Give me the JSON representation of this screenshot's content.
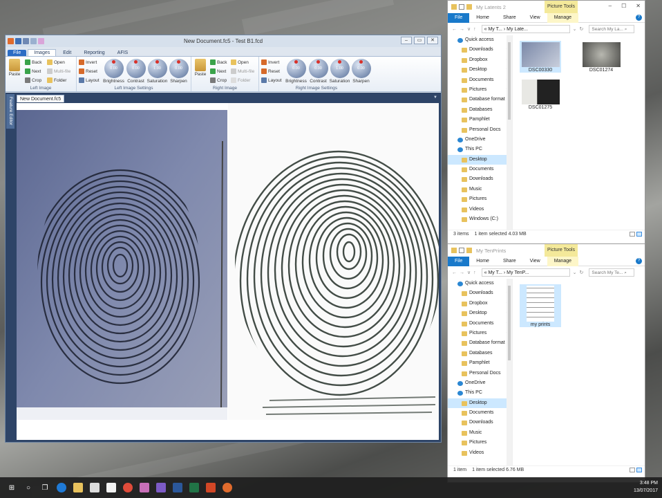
{
  "app": {
    "title": "New Document.fc5 - Test B1.fcd",
    "win_buttons": [
      "–",
      "▭",
      "✕"
    ],
    "tabs": [
      "File",
      "Images",
      "Edit",
      "Reporting",
      "AFIS"
    ],
    "active_tab": "Images",
    "left_group": {
      "paste": "Paste",
      "back": "Back",
      "next": "Next",
      "crop": "Crop",
      "open": "Open",
      "multifile": "Multi-file",
      "folder": "Folder",
      "label": "Left Image"
    },
    "left_settings": {
      "invert": "Invert",
      "reset": "Reset",
      "layout": "Layout",
      "knobs": [
        {
          "name": "Brightness",
          "value": "0.00"
        },
        {
          "name": "Contrast",
          "value": "0.00"
        },
        {
          "name": "Saturation",
          "value": "1.00"
        },
        {
          "name": "Sharpen",
          "value": "0.00"
        }
      ],
      "label": "Left Image Settings"
    },
    "right_group": {
      "paste": "Paste",
      "back": "Back",
      "next": "Next",
      "crop": "Crop",
      "open": "Open",
      "multifile": "Multi-file",
      "folder": "Folder",
      "label": "Right Image"
    },
    "right_settings": {
      "invert": "Invert",
      "reset": "Reset",
      "layout": "Layout",
      "knobs": [
        {
          "name": "Brightness",
          "value": "0.00"
        },
        {
          "name": "Contrast",
          "value": "0.00"
        },
        {
          "name": "Saturation",
          "value": "1.00"
        },
        {
          "name": "Sharpen",
          "value": "0.00"
        }
      ],
      "label": "Right Image Settings"
    },
    "side_tab": "Feature Editor",
    "doc_tab": "New Document.fc5",
    "doc_tab_arrow": "▼"
  },
  "explorer_top": {
    "title": "My Latents 2",
    "picture_tools": "Picture Tools",
    "window_controls": [
      "–",
      "☐",
      "✕"
    ],
    "tabs": [
      "File",
      "Home",
      "Share",
      "View",
      "Manage"
    ],
    "help": "?",
    "nav": [
      "←",
      "→",
      "∨",
      "↑"
    ],
    "address": "« My T... › My Late...",
    "address_end": "⌄",
    "refresh": "↻",
    "search_placeholder": "Search My La...",
    "search_icon": "⌕",
    "tree": [
      {
        "label": "Quick access",
        "top": true
      },
      {
        "label": "Downloads",
        "pin": true
      },
      {
        "label": "Dropbox",
        "pin": true
      },
      {
        "label": "Desktop",
        "pin": true
      },
      {
        "label": "Documents",
        "pin": true
      },
      {
        "label": "Pictures",
        "pin": true
      },
      {
        "label": "Database format"
      },
      {
        "label": "Databases"
      },
      {
        "label": "Pamphlet"
      },
      {
        "label": "Personal Docs"
      },
      {
        "label": "OneDrive",
        "top": true
      },
      {
        "label": "This PC",
        "top": true
      },
      {
        "label": "Desktop",
        "selected": true
      },
      {
        "label": "Documents"
      },
      {
        "label": "Downloads"
      },
      {
        "label": "Music"
      },
      {
        "label": "Pictures"
      },
      {
        "label": "Videos"
      },
      {
        "label": "Windows (C:)"
      }
    ],
    "files": [
      {
        "name": "DSC00330",
        "selected": true
      },
      {
        "name": "DSC01274"
      },
      {
        "name": "DSC01275"
      }
    ],
    "status_count": "3 items",
    "status_selected": "1 item selected  4.03 MB"
  },
  "explorer_bottom": {
    "title": "My TenPrints",
    "picture_tools": "Picture Tools",
    "tabs": [
      "File",
      "Home",
      "Share",
      "View",
      "Manage"
    ],
    "help": "?",
    "nav": [
      "←",
      "→",
      "∨",
      "↑"
    ],
    "address": "« My T... › My TenP...",
    "address_end": "⌄",
    "refresh": "↻",
    "search_placeholder": "Search My Te...",
    "search_icon": "⌕",
    "tree": [
      {
        "label": "Quick access",
        "top": true
      },
      {
        "label": "Downloads",
        "pin": true
      },
      {
        "label": "Dropbox",
        "pin": true
      },
      {
        "label": "Desktop",
        "pin": true
      },
      {
        "label": "Documents",
        "pin": true
      },
      {
        "label": "Pictures",
        "pin": true
      },
      {
        "label": "Database format"
      },
      {
        "label": "Databases"
      },
      {
        "label": "Pamphlet"
      },
      {
        "label": "Personal Docs"
      },
      {
        "label": "OneDrive",
        "top": true
      },
      {
        "label": "This PC",
        "top": true
      },
      {
        "label": "Desktop",
        "selected": true
      },
      {
        "label": "Documents"
      },
      {
        "label": "Downloads"
      },
      {
        "label": "Music"
      },
      {
        "label": "Pictures"
      },
      {
        "label": "Videos"
      }
    ],
    "files": [
      {
        "name": "my prints",
        "selected": true
      }
    ],
    "status_count": "1 item",
    "status_selected": "1 item selected  6.76 MB"
  },
  "taskbar": {
    "icons": [
      "start-icon",
      "search-icon",
      "task-view-icon",
      "edge-icon",
      "file-explorer-icon",
      "store-icon",
      "mail-icon",
      "chrome-icon",
      "paint-icon",
      "app-icon",
      "word-icon",
      "excel-icon",
      "powerpoint-icon",
      "fingerprint-app-icon"
    ],
    "glyphs": {
      "start": "⊞",
      "search": "○",
      "taskview": "❐"
    },
    "time": "3:48 PM",
    "date": "13/07/2017"
  },
  "colors": {
    "ribbon_accent": "#2b6cc4",
    "explorer_accent": "#1979ca",
    "picture_tools": "#f4e99a",
    "selection": "#cce8ff"
  }
}
